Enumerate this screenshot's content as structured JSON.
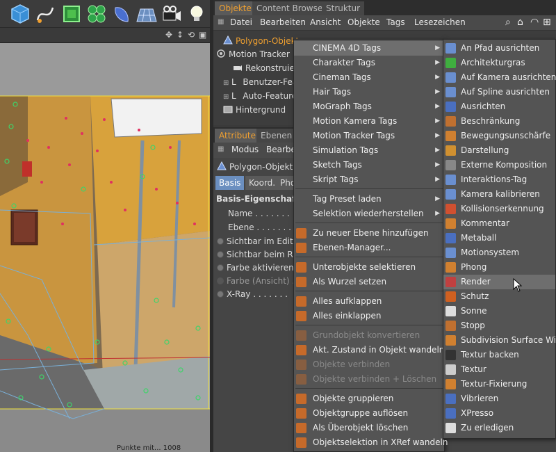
{
  "toolbar": {
    "icons": [
      "cube-icon",
      "spline-pen-icon",
      "subdivision-icon",
      "cloner-icon",
      "deformer-icon",
      "floor-icon",
      "camera-icon",
      "light-icon"
    ]
  },
  "right_tabs": [
    "Objekte",
    "Content Browser",
    "Struktur"
  ],
  "menubar": [
    "Datei",
    "Bearbeiten",
    "Ansicht",
    "Objekte",
    "Tags",
    "Lesezeichen"
  ],
  "objects": [
    {
      "label": "Polygon-Objekt",
      "icon": "polygon-object-icon"
    },
    {
      "label": "Motion Tracker",
      "icon": "motion-tracker-icon"
    },
    {
      "label": "Rekonstruier",
      "icon": "camera-icon"
    },
    {
      "label": "Benutzer-Fea",
      "icon": "null-icon"
    },
    {
      "label": "Auto-Feature",
      "icon": "null-icon"
    },
    {
      "label": "Hintergrund",
      "icon": "background-icon"
    }
  ],
  "attr": {
    "tabs": [
      "Attribute",
      "Ebenen"
    ],
    "menus": [
      "Modus",
      "Bearbei"
    ],
    "object_name": "Polygon-Objekt",
    "sub_tabs": [
      "Basis",
      "Koord.",
      "Pho"
    ],
    "section_title": "Basis-Eigenschafte",
    "fields": [
      "Name . . . . . . .",
      "Ebene . . . . . . ."
    ],
    "radio_fields": [
      "Sichtbar im Editor",
      "Sichtbar beim Ren",
      "Farbe aktivieren .",
      "Farbe (Ansicht) .",
      "X-Ray . . . . . . ."
    ]
  },
  "viewport_hud": "Punkte mit... 1008",
  "menu1": {
    "items": [
      {
        "label": "CINEMA 4D Tags",
        "submenu": true,
        "highlight": true
      },
      {
        "label": "Charakter Tags",
        "submenu": true
      },
      {
        "label": "Cineman Tags",
        "submenu": true
      },
      {
        "label": "Hair Tags",
        "submenu": true
      },
      {
        "label": "MoGraph Tags",
        "submenu": true
      },
      {
        "label": "Motion Kamera Tags",
        "submenu": true
      },
      {
        "label": "Motion Tracker Tags",
        "submenu": true
      },
      {
        "label": "Simulation Tags",
        "submenu": true
      },
      {
        "label": "Sketch Tags",
        "submenu": true
      },
      {
        "label": "Skript Tags",
        "submenu": true
      },
      {
        "label": "Tag Preset laden",
        "submenu": true,
        "sep_before": true
      },
      {
        "label": "Selektion wiederherstellen",
        "submenu": true
      },
      {
        "label": "Zu neuer Ebene hinzufügen",
        "icon": "layer-add-icon",
        "sep_before": true
      },
      {
        "label": "Ebenen-Manager...",
        "icon": "layer-manager-icon"
      },
      {
        "label": "Unterobjekte selektieren",
        "icon": "select-children-icon",
        "sep_before": true
      },
      {
        "label": "Als Wurzel setzen",
        "icon": "set-root-icon"
      },
      {
        "label": "Alles aufklappen",
        "icon": "expand-all-icon",
        "sep_before": true
      },
      {
        "label": "Alles einklappen",
        "icon": "collapse-all-icon"
      },
      {
        "label": "Grundobjekt konvertieren",
        "icon": "convert-icon",
        "sep_before": true,
        "disabled": true
      },
      {
        "label": "Akt. Zustand in Objekt wandeln",
        "icon": "current-state-icon"
      },
      {
        "label": "Objekte verbinden",
        "icon": "connect-icon",
        "disabled": true
      },
      {
        "label": "Objekte verbinden + Löschen",
        "icon": "connect-delete-icon",
        "disabled": true
      },
      {
        "label": "Objekte gruppieren",
        "icon": "group-icon",
        "sep_before": true
      },
      {
        "label": "Objektgruppe auflösen",
        "icon": "ungroup-icon"
      },
      {
        "label": "Als Überobjekt löschen",
        "icon": "delete-parent-icon"
      },
      {
        "label": "Objektselektion in XRef wandeln",
        "icon": "xref-icon"
      }
    ]
  },
  "menu2": {
    "items": [
      {
        "label": "An Pfad ausrichten",
        "icon": "align-path-icon",
        "color": "#6a8fd0"
      },
      {
        "label": "Architekturgras",
        "icon": "grass-icon",
        "color": "#3fae3f"
      },
      {
        "label": "Auf Kamera ausrichten",
        "icon": "align-camera-icon",
        "color": "#6a8fd0"
      },
      {
        "label": "Auf Spline ausrichten",
        "icon": "align-spline-icon",
        "color": "#6a8fd0"
      },
      {
        "label": "Ausrichten",
        "icon": "target-icon",
        "color": "#4a6fc0"
      },
      {
        "label": "Beschränkung",
        "icon": "constraint-icon",
        "color": "#c07030"
      },
      {
        "label": "Bewegungsunschärfe",
        "icon": "motion-blur-icon",
        "color": "#d08030"
      },
      {
        "label": "Darstellung",
        "icon": "display-icon",
        "color": "#d09030"
      },
      {
        "label": "Externe Komposition",
        "icon": "compositing-icon",
        "color": "#888888"
      },
      {
        "label": "Interaktions-Tag",
        "icon": "interaction-icon",
        "color": "#6a8fd0"
      },
      {
        "label": "Kamera kalibrieren",
        "icon": "calibrate-icon",
        "color": "#6a8fd0"
      },
      {
        "label": "Kollisionserkennung",
        "icon": "collision-icon",
        "color": "#d05030"
      },
      {
        "label": "Kommentar",
        "icon": "comment-icon",
        "color": "#d08030"
      },
      {
        "label": "Metaball",
        "icon": "metaball-icon",
        "color": "#4a6fc0"
      },
      {
        "label": "Motionsystem",
        "icon": "motion-system-icon",
        "color": "#6a8fd0"
      },
      {
        "label": "Phong",
        "icon": "phong-icon",
        "color": "#d08030"
      },
      {
        "label": "Render",
        "icon": "render-icon",
        "color": "#c04040",
        "highlight": true
      },
      {
        "label": "Schutz",
        "icon": "protection-icon",
        "color": "#d06020"
      },
      {
        "label": "Sonne",
        "icon": "sun-icon",
        "color": "#dddddd"
      },
      {
        "label": "Stopp",
        "icon": "stop-icon",
        "color": "#c07030"
      },
      {
        "label": "Subdivision Surface Wichtu",
        "icon": "subdivision-weight-icon",
        "color": "#d08030"
      },
      {
        "label": "Textur backen",
        "icon": "bake-texture-icon",
        "color": "#333333"
      },
      {
        "label": "Textur",
        "icon": "texture-icon",
        "color": "#cccccc"
      },
      {
        "label": "Textur-Fixierung",
        "icon": "texture-fix-icon",
        "color": "#d08030"
      },
      {
        "label": "Vibrieren",
        "icon": "vibrate-icon",
        "color": "#4a6fc0"
      },
      {
        "label": "XPresso",
        "icon": "xpresso-icon",
        "color": "#4a6fc0"
      },
      {
        "label": "Zu erledigen",
        "icon": "todo-icon",
        "color": "#dddddd"
      }
    ]
  }
}
